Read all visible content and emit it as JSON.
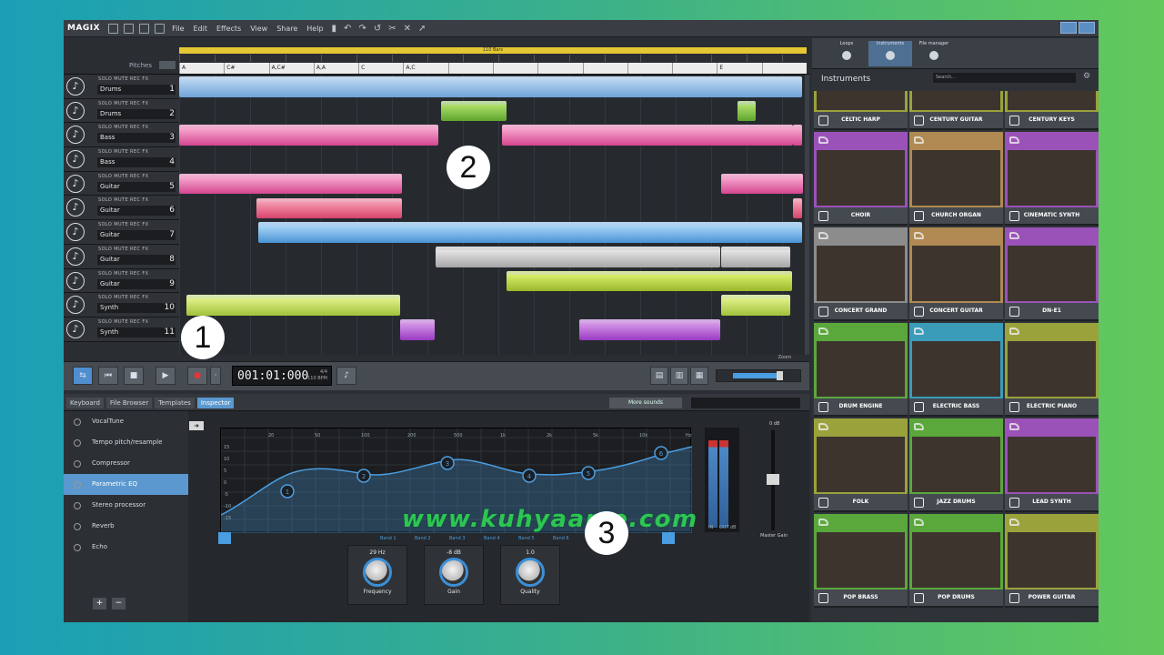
{
  "app": {
    "logo": "MAGIX"
  },
  "menu": [
    "File",
    "Edit",
    "Effects",
    "View",
    "Share",
    "Help"
  ],
  "toolbar_icons": [
    "undo-icon",
    "redo-icon",
    "cut-icon",
    "delete-icon",
    "pointer-icon"
  ],
  "arranger": {
    "pitches_label": "Pitches",
    "loop_label": "110 Bars",
    "chords": [
      "A",
      "C#",
      "A,C#",
      "A,A",
      "C",
      "A,C",
      "",
      "",
      "",
      "",
      "",
      "",
      "E",
      ""
    ],
    "tracks": [
      {
        "name": "Drums",
        "num": "1",
        "icon": "drums-icon"
      },
      {
        "name": "Drums",
        "num": "2",
        "icon": "drums-icon"
      },
      {
        "name": "Bass",
        "num": "3",
        "icon": "bass-icon"
      },
      {
        "name": "Bass",
        "num": "4",
        "icon": "bass-icon"
      },
      {
        "name": "Guitar",
        "num": "5",
        "icon": "guitar-icon"
      },
      {
        "name": "Guitar",
        "num": "6",
        "icon": "guitar-icon"
      },
      {
        "name": "Guitar",
        "num": "7",
        "icon": "guitar-icon"
      },
      {
        "name": "Guitar",
        "num": "8",
        "icon": "guitar-icon"
      },
      {
        "name": "Guitar",
        "num": "9",
        "icon": "guitar-icon"
      },
      {
        "name": "Synth",
        "num": "10",
        "icon": "keyboard-icon"
      },
      {
        "name": "Synth",
        "num": "11",
        "icon": "keyboard-icon"
      }
    ],
    "track_buttons": "SOLO  MUTE   REC   FX",
    "zoom_label": "Zoom"
  },
  "transport": {
    "time": "001:01:000",
    "time_sig": "4/4",
    "tempo": "110 BPM"
  },
  "inspector": {
    "tabs": [
      "Keyboard",
      "File Browser",
      "Templates",
      "Inspector"
    ],
    "active_tab": "Inspector",
    "more_sounds": "More sounds",
    "effects": [
      "VocalTune",
      "Tempo pitch/resample",
      "Compressor",
      "Parametric EQ",
      "Stereo processor",
      "Reverb",
      "Echo"
    ],
    "selected_effect": "Parametric EQ",
    "eq_freq_labels": [
      "20",
      "50",
      "100",
      "200",
      "500",
      "1k",
      "2k",
      "5k",
      "10k",
      "Hz"
    ],
    "eq_db_labels": [
      "15",
      "10",
      "5",
      "0",
      "-5",
      "-10",
      "-15"
    ],
    "bands": [
      "Band 1",
      "Band 2",
      "Band 3",
      "Band 4",
      "Band 5",
      "Band 6"
    ],
    "meter_labels": [
      "IN",
      "OUT",
      "dB"
    ],
    "master_gain_value": "0 dB",
    "master_gain_label": "Master Gain",
    "knobs": [
      {
        "value": "29 Hz",
        "label": "Frequency"
      },
      {
        "value": "-8 dB",
        "label": "Gain"
      },
      {
        "value": "1.0",
        "label": "Quality"
      }
    ]
  },
  "panel": {
    "tabs": [
      "Loops",
      "Instruments",
      "File manager"
    ],
    "active_tab": "Instruments",
    "title": "Instruments",
    "search_placeholder": "Search...",
    "instruments": [
      {
        "name": "CELTIC HARP",
        "color": "#9aa23c"
      },
      {
        "name": "CENTURY GUITAR",
        "color": "#9aa23c"
      },
      {
        "name": "CENTURY KEYS",
        "color": "#9aa23c"
      },
      {
        "name": "CHOIR",
        "color": "#9a52b8"
      },
      {
        "name": "CHURCH ORGAN",
        "color": "#b08a52"
      },
      {
        "name": "CINEMATIC SYNTH",
        "color": "#9a52b8"
      },
      {
        "name": "CONCERT GRAND",
        "color": "#8c8c8c"
      },
      {
        "name": "CONCERT GUITAR",
        "color": "#b08a52"
      },
      {
        "name": "DN-E1",
        "color": "#9a52b8"
      },
      {
        "name": "DRUM ENGINE",
        "color": "#5aa83c"
      },
      {
        "name": "ELECTRIC BASS",
        "color": "#3a9cb8"
      },
      {
        "name": "ELECTRIC PIANO",
        "color": "#9aa23c"
      },
      {
        "name": "FOLK",
        "color": "#9aa23c"
      },
      {
        "name": "JAZZ DRUMS",
        "color": "#5aa83c"
      },
      {
        "name": "LEAD SYNTH",
        "color": "#9a52b8"
      },
      {
        "name": "POP BRASS",
        "color": "#5aa83c"
      },
      {
        "name": "POP DRUMS",
        "color": "#5aa83c"
      },
      {
        "name": "POWER GUITAR",
        "color": "#9aa23c"
      }
    ]
  },
  "watermark": "www.kuhyaame.com",
  "markers": [
    "1",
    "2",
    "3"
  ]
}
